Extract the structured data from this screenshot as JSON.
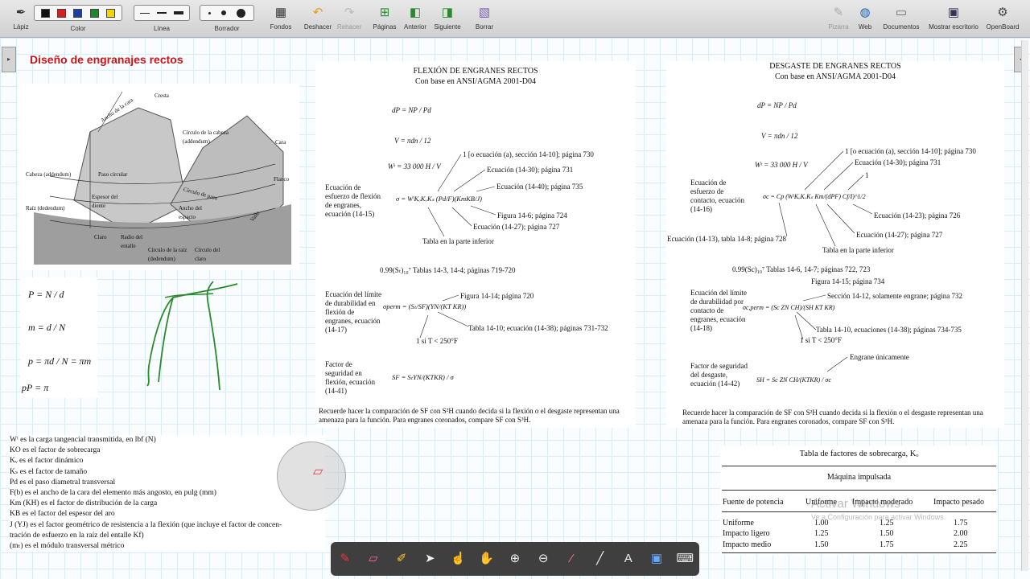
{
  "toolbar": {
    "left": [
      {
        "label": "Lápiz",
        "icon": "pen-icon"
      },
      {
        "label": "Color",
        "icon": "color-palette-icon"
      },
      {
        "label": "Línea",
        "icon": "line-width-icon"
      },
      {
        "label": "Borrador",
        "icon": "eraser-size-icon"
      },
      {
        "label": "Fondos",
        "icon": "backgrounds-icon"
      },
      {
        "label": "Deshacer",
        "icon": "undo-icon"
      },
      {
        "label": "Rehacer",
        "icon": "redo-icon"
      },
      {
        "label": "Páginas",
        "icon": "pages-icon"
      },
      {
        "label": "Anterior",
        "icon": "previous-page-icon"
      },
      {
        "label": "Siguiente",
        "icon": "next-page-icon"
      },
      {
        "label": "Borrar",
        "icon": "clear-page-icon"
      }
    ],
    "right": [
      {
        "label": "Pizarra",
        "icon": "board-icon"
      },
      {
        "label": "Web",
        "icon": "globe-icon"
      },
      {
        "label": "Documentos",
        "icon": "folder-icon"
      },
      {
        "label": "Mostrar escritorio",
        "icon": "desktop-icon"
      },
      {
        "label": "OpenBoard",
        "icon": "settings-icon"
      }
    ],
    "colors": [
      "#111111",
      "#d42020",
      "#1d3fa0",
      "#1b8a2a",
      "#f2d400"
    ]
  },
  "page_title": "Diseño de engranajes rectos",
  "gear_labels": {
    "cresta": "Cresta",
    "ancho_cara": "Ancho de la cara",
    "circulo_cabeza": "Círculo de la cabeza (addendum)",
    "cara": "Cara",
    "cabeza": "Cabeza (addendum)",
    "paso_circular": "Paso circular",
    "flanco": "Flanco",
    "circulo_paso": "Círculo de paso",
    "espesor": "Espesor del diente",
    "raiz": "Raíz (dedendum)",
    "ancho_espacio": "Ancho del espacio",
    "valle": "Valle",
    "claro": "Claro",
    "radio": "Radio del entalle",
    "circulo_raiz": "Círculo de la raíz (dedendum)",
    "circulo_claro": "Círculo del claro"
  },
  "formulas": [
    "P = N / d",
    "m = d / N",
    "p = πd / N = πm",
    "pP = π"
  ],
  "flexion": {
    "title": "FLEXIÓN DE ENGRANES RECTOS",
    "subtitle": "Con base en ANSI/AGMA 2001-D04",
    "eq_dp": "dP = NP / Pd",
    "eq_v": "V = πdn / 12",
    "eq_wt": "Wᵗ = 33 000 H / V",
    "eq_sigma": "σ = WᵗKₒKᵥKₛ (Pd/F)(KmKB/J)",
    "label_eq": "Ecuación de esfuerzo de flexión de engranes, ecuación (14-15)",
    "ann": [
      "1 [o ecuación (a), sección 14-10]; página 730",
      "Ecuación (14-30); página 731",
      "Ecuación (14-40); página 735",
      "Figura 14-6; página 724",
      "Ecuación (14-27); página 727",
      "Tabla en la parte inferior"
    ],
    "st_note": "0.99(Sₜ)₁₀⁷ Tablas 14-3, 14-4; páginas 719-720",
    "eq_perm": "σperm = (Sₜ/SF)(YN/(KT KR))",
    "label_perm": "Ecuación del límite de durabilidad en flexión de engranes, ecuación (14-17)",
    "ann2": [
      "Figura 14-14; página 720",
      "Tabla 14-10; ecuación (14-38); páginas 731-732",
      "1 si T < 250°F"
    ],
    "eq_sf": "SF = SₜYN/(KTKR) / σ",
    "label_sf": "Factor de seguridad en flexión, ecuación (14-41)",
    "note": "Recuerde hacer la comparación de SF con S²H cuando decida si la flexión o el desgaste representan una amenaza para la función. Para engranes coronados, compare SF con S³H."
  },
  "desgaste": {
    "title": "DESGASTE DE ENGRANES RECTOS",
    "subtitle": "Con base en ANSI/AGMA 2001-D04",
    "eq_dp": "dP = NP / Pd",
    "eq_v": "V = πdn / 12",
    "eq_wt": "Wᵗ = 33 000 H / V",
    "eq_sigma": "σc = Cp (WᵗKₒKᵥKₛ Km/(dPF) Cf/I)^1/2",
    "label_eq": "Ecuación de esfuerzo de contacto, ecuación (14-16)",
    "ann": [
      "1 [o ecuación (a), sección 14-10]; página 730",
      "Ecuación (14-30); página 731",
      "1",
      "Ecuación (14-23); página 726",
      "Ecuación (14-27); página 727",
      "Tabla en la parte inferior",
      "Ecuación (14-13), tabla 14-8; página 728"
    ],
    "sc_note": "0.99(Sc)₁₀⁷ Tablas 14-6, 14-7; páginas 722, 723",
    "eq_perm": "σc,perm = (Sc ZN CH)/(SH KT KR)",
    "label_perm": "Ecuación del límite de durabilidad por contacto de engranes, ecuación (14-18)",
    "ann2": [
      "Figura 14-15; página 734",
      "Sección 14-12, solamente engrane; página 732",
      "Tabla 14-10, ecuaciones (14-38); páginas 734-735",
      "1 si T < 250°F",
      "Engrane únicamente"
    ],
    "eq_sh": "SH = Sc ZN CH/(KTKR) / σc",
    "label_sh": "Factor de seguridad del desgaste, ecuación (14-42)",
    "note": "Recuerde hacer la comparación de SF con S²H cuando decida si la flexión o el desgaste representan una amenaza para la función. Para engranes coronados, compare SF con S³H."
  },
  "definitions": [
    "Wᵗ es la carga tangencial transmitida, en lbf (N)",
    "KO es el factor de sobrecarga",
    "Kᵥ es el factor dinámico",
    "Kₛ es el factor de tamaño",
    "Pd es el paso diametral transversal",
    "F(b) es el ancho de la cara del elemento más angosto, en pulg (mm)",
    "Km (KH) es el factor de distribución de la carga",
    "KB es el factor del espesor del aro",
    "J (YJ) es el factor geométrico de resistencia a la flexión (que incluye el factor de concen-",
    "tración de esfuerzo en la raíz del entalle Kf)",
    "(mₜ) es el módulo transversal métrico"
  ],
  "overload_table": {
    "title": "Tabla de factores de sobrecarga, Kₒ",
    "group": "Máquina impulsada",
    "headers": [
      "Fuente de potencia",
      "Uniforme",
      "Impacto moderado",
      "Impacto pesado"
    ],
    "rows": [
      [
        "Uniforme",
        "1.00",
        "1.25",
        "1.75"
      ],
      [
        "Impacto ligero",
        "1.25",
        "1.50",
        "2.00"
      ],
      [
        "Impacto medio",
        "1.50",
        "1.75",
        "2.25"
      ]
    ]
  },
  "watermark": {
    "line1": "Activar Windows",
    "line2": "Ve a Configuración para activar Windows."
  },
  "bottom_tools": [
    "pen-icon",
    "eraser-icon",
    "marker-icon",
    "pointer-icon",
    "hand-pointer-icon",
    "hand-icon",
    "zoom-in-icon",
    "zoom-out-icon",
    "laser-icon",
    "line-icon",
    "text-icon",
    "capture-icon",
    "keyboard-icon"
  ]
}
